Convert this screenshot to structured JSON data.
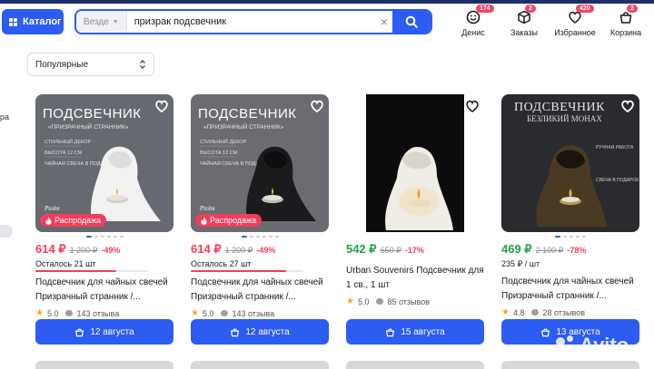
{
  "header": {
    "catalog_label": "Каталог",
    "search_scope": "Везде",
    "search_value": "призрак подсвечник",
    "nav": [
      {
        "label": "Денис",
        "badge": "174",
        "icon": "smiley-icon"
      },
      {
        "label": "Заказы",
        "badge": "2",
        "icon": "box-icon"
      },
      {
        "label": "Избранное",
        "badge": "420",
        "icon": "heart-icon"
      },
      {
        "label": "Корзина",
        "badge": "2",
        "icon": "cart-icon"
      }
    ]
  },
  "sort": {
    "label": "Популярные"
  },
  "left_fragment": "ра",
  "products": [
    {
      "image_caption": "ПОДСВЕЧНИК",
      "image_subtitle": "«ПРИЗРАЧНЫЙ СТРАННИК»",
      "image_bullets": [
        "СТИЛЬНЫЙ ДЕКОР",
        "ВЫСОТА 12 СМ",
        "ЧАЙНАЯ СВЕЧА В ПОДАРОК"
      ],
      "image_brand": "Ptolm",
      "sale_badge": "Распродажа",
      "price": "614 ₽",
      "old_price": "1 200 ₽",
      "discount": "-49%",
      "stock": "Осталось 21 шт",
      "stock_fraction": 0.72,
      "title": "Подсвечник для чайных свечей Призрачный странник /...",
      "rating": "5.0",
      "reviews": "143 отзыва",
      "delivery": "12 августа",
      "price_color": "#f13e5b",
      "figure": "white"
    },
    {
      "image_caption": "ПОДСВЕЧНИК",
      "image_subtitle": "«ПРИЗРАЧНЫЙ СТРАННИК»",
      "image_bullets": [
        "СТИЛЬНЫЙ ДЕКОР",
        "ВЫСОТА 12 СМ",
        "ЧАЙНАЯ СВЕЧА В ПОДАРОК"
      ],
      "image_brand": "Ptolm",
      "sale_badge": "Распродажа",
      "price": "614 ₽",
      "old_price": "1 200 ₽",
      "discount": "-49%",
      "stock": "Осталось 27 шт",
      "stock_fraction": 0.85,
      "title": "Подсвечник для чайных свечей Призрачный странник /...",
      "rating": "5.0",
      "reviews": "143 отзыва",
      "delivery": "12 августа",
      "price_color": "#f13e5b",
      "figure": "black"
    },
    {
      "price": "542 ₽",
      "old_price": "650 ₽",
      "discount": "-17%",
      "title": "Urban Souvenirs Подсвечник для 1 св., 1 шт",
      "rating": "5.0",
      "reviews": "85 отзывов",
      "delivery": "15 августа",
      "price_color": "#22a34a",
      "figure": "lit"
    },
    {
      "image_caption": "ПОДСВЕЧНИК",
      "image_subtitle": "БЕЗЛИКИЙ МОНАХ",
      "image_bullets": [
        "РУЧНАЯ РАБОТА",
        "СВЕЧА В ПОДАРОК"
      ],
      "price": "469 ₽",
      "old_price": "2 100 ₽",
      "discount": "-78%",
      "stock": "235 ₽ / шт",
      "title": "Подсвечник для чайных свечей Призрачный странник /...",
      "rating": "4.8",
      "reviews": "28 отзывов",
      "delivery": "13 августа",
      "price_color": "#22a34a",
      "figure": "bronze"
    }
  ],
  "watermark": "Avito",
  "colors": {
    "accent": "#2c5cf2",
    "sale": "#f13e5b",
    "green": "#22a34a",
    "badge": "#f2456a"
  }
}
